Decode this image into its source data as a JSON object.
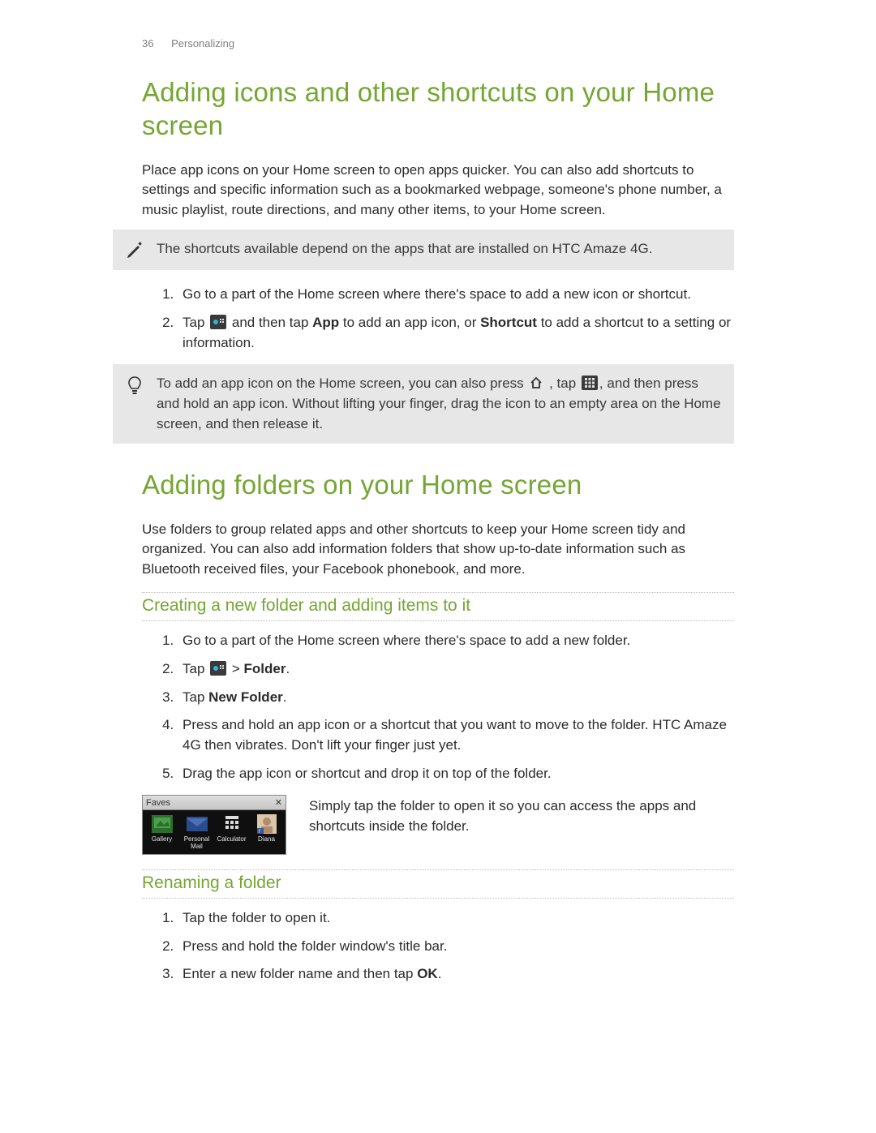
{
  "header": {
    "page_number": "36",
    "section": "Personalizing"
  },
  "section1": {
    "title": "Adding icons and other shortcuts on your Home screen",
    "intro": "Place app icons on your Home screen to open apps quicker. You can also add shortcuts to settings and specific information such as a bookmarked webpage, someone's phone number, a music playlist, route directions, and many other items, to your Home screen.",
    "note": "The shortcuts available depend on the apps that are installed on HTC Amaze 4G.",
    "step1": "Go to a part of the Home screen where there's space to add a new icon or shortcut.",
    "step2_a": "Tap ",
    "step2_b": " and then tap ",
    "step2_app": "App",
    "step2_c": " to add an app icon, or ",
    "step2_shortcut": "Shortcut",
    "step2_d": " to add a shortcut to a setting or information.",
    "tip_a": "To add an app icon on the Home screen, you can also press ",
    "tip_b": " , tap ",
    "tip_c": ", and then press and hold an app icon. Without lifting your finger, drag the icon to an empty area on the Home screen, and then release it."
  },
  "section2": {
    "title": "Adding folders on your Home screen",
    "intro": "Use folders to group related apps and other shortcuts to keep your Home screen tidy and organized. You can also add information folders that show up-to-date information such as Bluetooth received files, your Facebook phonebook, and more.",
    "sub1": {
      "title": "Creating a new folder and adding items to it",
      "step1": "Go to a part of the Home screen where there's space to add a new folder.",
      "step2_a": "Tap ",
      "step2_b": " > ",
      "step2_folder": "Folder",
      "step2_c": ".",
      "step3_a": "Tap ",
      "step3_nf": "New Folder",
      "step3_b": ".",
      "step4": "Press and hold an app icon or a shortcut that you want to move to the folder. HTC Amaze 4G then vibrates. Don't lift your finger just yet.",
      "step5": "Drag the app icon or shortcut and drop it on top of the folder.",
      "folder_caption": "Simply tap the folder to open it so you can access the apps and shortcuts inside the folder.",
      "popup": {
        "title": "Faves",
        "items": [
          "Gallery",
          "Personal Mail",
          "Calculator",
          "Diana"
        ]
      }
    },
    "sub2": {
      "title": "Renaming a folder",
      "step1": "Tap the folder to open it.",
      "step2": "Press and hold the folder window's title bar.",
      "step3_a": "Enter a new folder name and then tap ",
      "step3_ok": "OK",
      "step3_b": "."
    }
  }
}
